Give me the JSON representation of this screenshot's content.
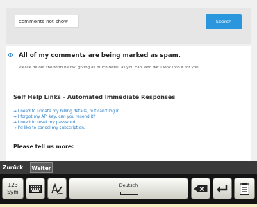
{
  "search": {
    "value": "comments not show",
    "button_label": "Search"
  },
  "question": {
    "title": "All of my comments are being marked as spam.",
    "description": "Please fill out the form below, giving as much detail as you can, and we'll look into it for you."
  },
  "self_help": {
    "title": "Self Help Links - Automated Immediate Responses",
    "links": [
      "→ I need to update my billing details, but can't log in.",
      "→ I forgot my API key, can you resend it?",
      "→ I need to reset my password.",
      "→ I'd like to cancel my subscription."
    ]
  },
  "tell_more": "Please tell us more:",
  "nav": {
    "back_label": "Zurück",
    "next_label": "Weiter"
  },
  "keyboard": {
    "sym_line1": "123",
    "sym_line2": "Sym",
    "space_label": "Deutsch",
    "icons": [
      "keyboard-icon",
      "handwriting-icon",
      "backspace-icon",
      "enter-icon",
      "clipboard-icon"
    ]
  }
}
